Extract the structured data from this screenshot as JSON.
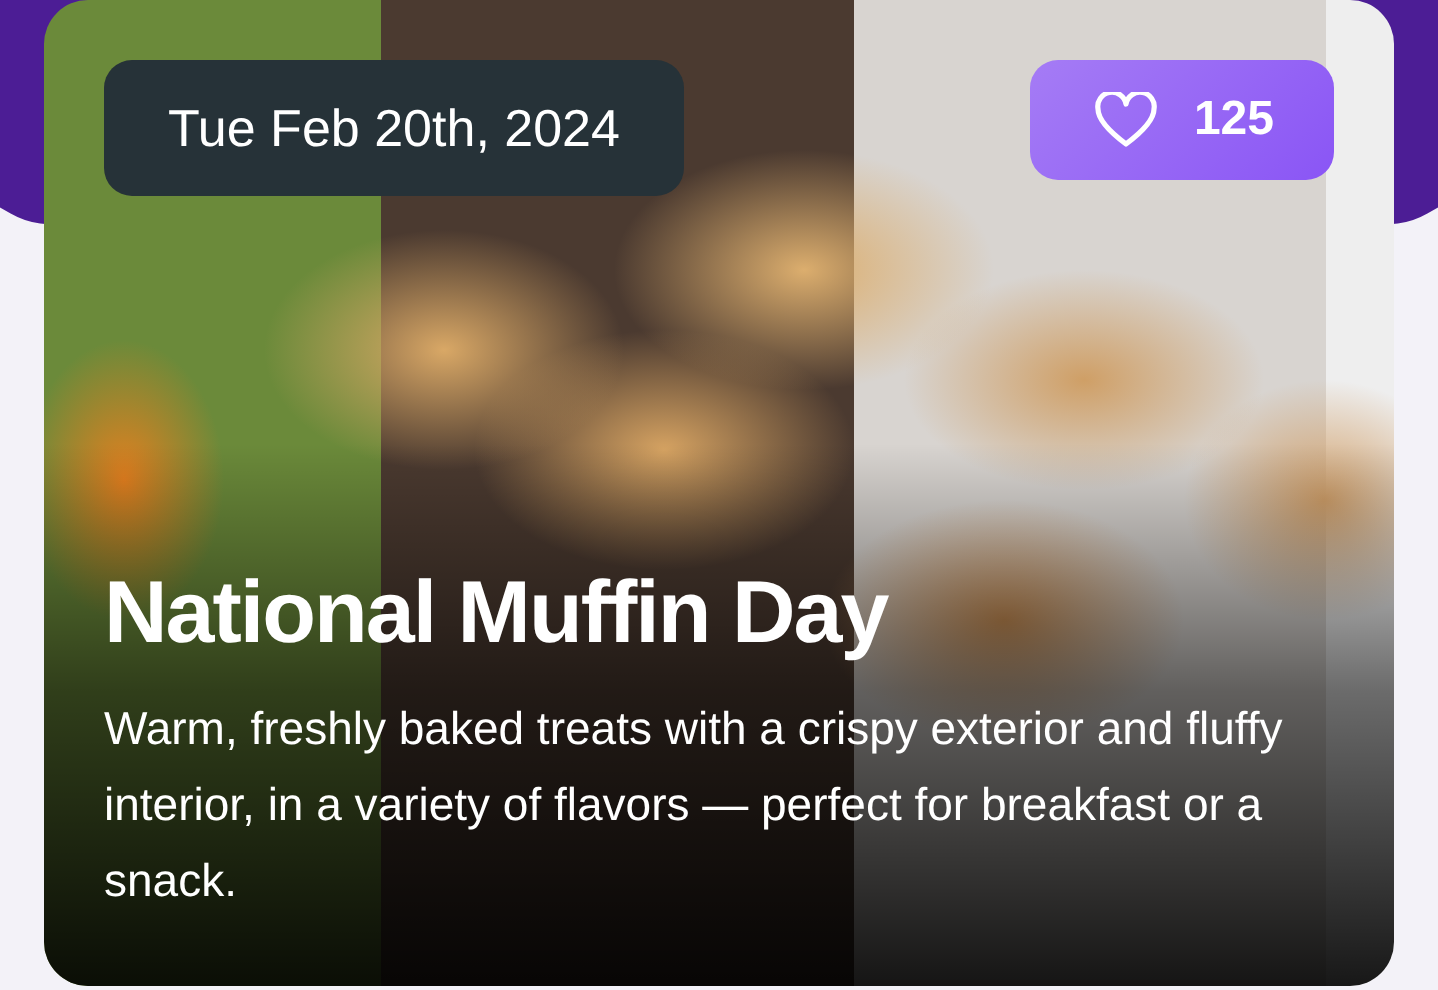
{
  "card": {
    "date": "Tue Feb 20th, 2024",
    "likes": {
      "count": "125",
      "liked": false
    },
    "title": "National Muffin Day",
    "description": "Warm, freshly baked treats with a crispy exterior and fluffy interior, in a variety of flavors — perfect for breakfast or a snack."
  }
}
